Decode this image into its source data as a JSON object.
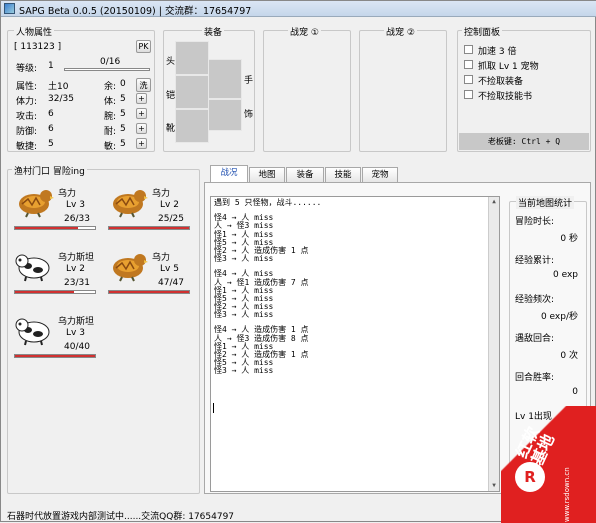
{
  "window": {
    "title": "SAPG Beta 0.0.5 (20150109) | 交流群：17654797"
  },
  "attrs": {
    "group": "人物属性",
    "id": "[ 113123 ]",
    "pk": "PK",
    "level_label": "等级:",
    "level": "1",
    "exp": "0/16",
    "rows": [
      {
        "l": "属性:",
        "v": "土10",
        "r": "余:",
        "rv": "0",
        "btn": "洗"
      },
      {
        "l": "体力:",
        "v": "32/35",
        "r": "体:",
        "rv": "5",
        "btn": "+"
      },
      {
        "l": "攻击:",
        "v": "6",
        "r": "腕:",
        "rv": "5",
        "btn": "+"
      },
      {
        "l": "防御:",
        "v": "6",
        "r": "耐:",
        "rv": "5",
        "btn": "+"
      },
      {
        "l": "敏捷:",
        "v": "5",
        "r": "敏:",
        "rv": "5",
        "btn": "+"
      }
    ]
  },
  "equip": {
    "group": "装备",
    "head": "头",
    "armor": "铠",
    "boots": "靴",
    "hand": "手",
    "ring": "饰"
  },
  "pet1": {
    "group": "战宠 ①"
  },
  "pet2": {
    "group": "战宠 ②"
  },
  "ctrl": {
    "group": "控制面板",
    "opts": [
      "加速 3 倍",
      "抓取 Lv 1 宠物",
      "不捡取装备",
      "不捡取技能书"
    ],
    "boss_key": "老板键: Ctrl + Q"
  },
  "party": {
    "location": "渔村门口 冒险ing",
    "members": [
      {
        "name": "乌力",
        "lv": "Lv 3",
        "hp": "26/33",
        "pct": 0.79,
        "kind": "duck"
      },
      {
        "name": "乌力",
        "lv": "Lv 2",
        "hp": "25/25",
        "pct": 1.0,
        "kind": "duck"
      },
      {
        "name": "乌力斯坦",
        "lv": "Lv 2",
        "hp": "23/31",
        "pct": 0.74,
        "kind": "cow"
      },
      {
        "name": "乌力",
        "lv": "Lv 5",
        "hp": "47/47",
        "pct": 1.0,
        "kind": "duck"
      },
      {
        "name": "乌力斯坦",
        "lv": "Lv 3",
        "hp": "40/40",
        "pct": 1.0,
        "kind": "cow"
      }
    ]
  },
  "tabs": [
    "战况",
    "地图",
    "装备",
    "技能",
    "宠物"
  ],
  "log": [
    "遇到 5 只怪物，战斗......",
    "",
    "怪4 → 人 miss",
    "人 → 怪3 miss",
    "怪1 → 人 miss",
    "怪5 → 人 miss",
    "怪2 → 人 造成伤害 1 点",
    "怪3 → 人 miss",
    "",
    "怪4 → 人 miss",
    "人 → 怪1 造成伤害 7 点",
    "怪1 → 人 miss",
    "怪5 → 人 miss",
    "怪2 → 人 miss",
    "怪3 → 人 miss",
    "",
    "怪4 → 人 造成伤害 1 点",
    "人 → 怪3 造成伤害 8 点",
    "怪1 → 人 miss",
    "怪2 → 人 造成伤害 1 点",
    "怪5 → 人 miss",
    "怪3 → 人 miss"
  ],
  "stats": {
    "group": "当前地图统计",
    "items": [
      {
        "label": "冒险时长:",
        "value": "0 秒"
      },
      {
        "label": "经验累计:",
        "value": "0 exp"
      },
      {
        "label": "经验频次:",
        "value": "0 exp/秒"
      },
      {
        "label": "遇敌回合:",
        "value": "0 次"
      },
      {
        "label": "回合胜率:",
        "value": "0"
      },
      {
        "label": "Lv 1出现",
        "value": ""
      }
    ]
  },
  "status": "石器时代放置游戏内部测试中......交流QQ群: 17654797",
  "watermark": {
    "brand": "红软基地",
    "url": "www.rsdown.cn"
  }
}
